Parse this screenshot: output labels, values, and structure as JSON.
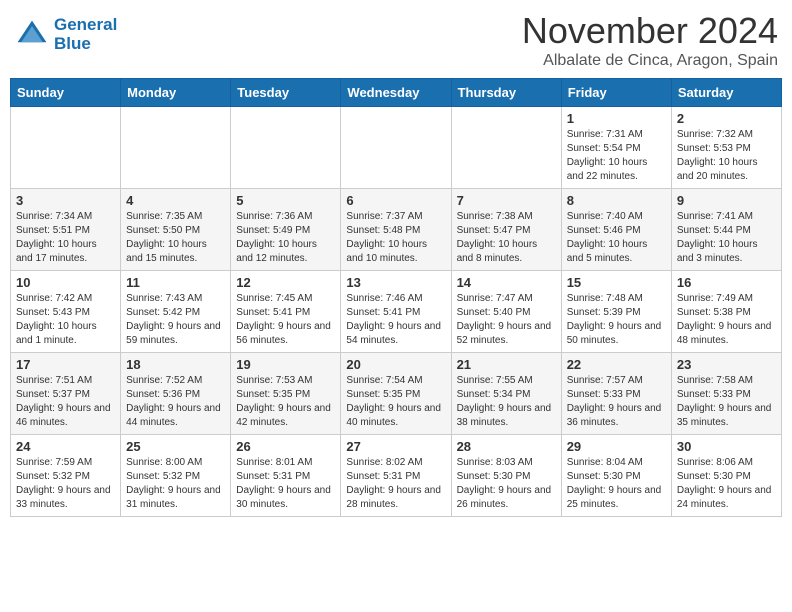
{
  "header": {
    "logo_line1": "General",
    "logo_line2": "Blue",
    "month_title": "November 2024",
    "location": "Albalate de Cinca, Aragon, Spain"
  },
  "weekdays": [
    "Sunday",
    "Monday",
    "Tuesday",
    "Wednesday",
    "Thursday",
    "Friday",
    "Saturday"
  ],
  "weeks": [
    [
      {
        "day": "",
        "info": ""
      },
      {
        "day": "",
        "info": ""
      },
      {
        "day": "",
        "info": ""
      },
      {
        "day": "",
        "info": ""
      },
      {
        "day": "",
        "info": ""
      },
      {
        "day": "1",
        "info": "Sunrise: 7:31 AM\nSunset: 5:54 PM\nDaylight: 10 hours and 22 minutes."
      },
      {
        "day": "2",
        "info": "Sunrise: 7:32 AM\nSunset: 5:53 PM\nDaylight: 10 hours and 20 minutes."
      }
    ],
    [
      {
        "day": "3",
        "info": "Sunrise: 7:34 AM\nSunset: 5:51 PM\nDaylight: 10 hours and 17 minutes."
      },
      {
        "day": "4",
        "info": "Sunrise: 7:35 AM\nSunset: 5:50 PM\nDaylight: 10 hours and 15 minutes."
      },
      {
        "day": "5",
        "info": "Sunrise: 7:36 AM\nSunset: 5:49 PM\nDaylight: 10 hours and 12 minutes."
      },
      {
        "day": "6",
        "info": "Sunrise: 7:37 AM\nSunset: 5:48 PM\nDaylight: 10 hours and 10 minutes."
      },
      {
        "day": "7",
        "info": "Sunrise: 7:38 AM\nSunset: 5:47 PM\nDaylight: 10 hours and 8 minutes."
      },
      {
        "day": "8",
        "info": "Sunrise: 7:40 AM\nSunset: 5:46 PM\nDaylight: 10 hours and 5 minutes."
      },
      {
        "day": "9",
        "info": "Sunrise: 7:41 AM\nSunset: 5:44 PM\nDaylight: 10 hours and 3 minutes."
      }
    ],
    [
      {
        "day": "10",
        "info": "Sunrise: 7:42 AM\nSunset: 5:43 PM\nDaylight: 10 hours and 1 minute."
      },
      {
        "day": "11",
        "info": "Sunrise: 7:43 AM\nSunset: 5:42 PM\nDaylight: 9 hours and 59 minutes."
      },
      {
        "day": "12",
        "info": "Sunrise: 7:45 AM\nSunset: 5:41 PM\nDaylight: 9 hours and 56 minutes."
      },
      {
        "day": "13",
        "info": "Sunrise: 7:46 AM\nSunset: 5:41 PM\nDaylight: 9 hours and 54 minutes."
      },
      {
        "day": "14",
        "info": "Sunrise: 7:47 AM\nSunset: 5:40 PM\nDaylight: 9 hours and 52 minutes."
      },
      {
        "day": "15",
        "info": "Sunrise: 7:48 AM\nSunset: 5:39 PM\nDaylight: 9 hours and 50 minutes."
      },
      {
        "day": "16",
        "info": "Sunrise: 7:49 AM\nSunset: 5:38 PM\nDaylight: 9 hours and 48 minutes."
      }
    ],
    [
      {
        "day": "17",
        "info": "Sunrise: 7:51 AM\nSunset: 5:37 PM\nDaylight: 9 hours and 46 minutes."
      },
      {
        "day": "18",
        "info": "Sunrise: 7:52 AM\nSunset: 5:36 PM\nDaylight: 9 hours and 44 minutes."
      },
      {
        "day": "19",
        "info": "Sunrise: 7:53 AM\nSunset: 5:35 PM\nDaylight: 9 hours and 42 minutes."
      },
      {
        "day": "20",
        "info": "Sunrise: 7:54 AM\nSunset: 5:35 PM\nDaylight: 9 hours and 40 minutes."
      },
      {
        "day": "21",
        "info": "Sunrise: 7:55 AM\nSunset: 5:34 PM\nDaylight: 9 hours and 38 minutes."
      },
      {
        "day": "22",
        "info": "Sunrise: 7:57 AM\nSunset: 5:33 PM\nDaylight: 9 hours and 36 minutes."
      },
      {
        "day": "23",
        "info": "Sunrise: 7:58 AM\nSunset: 5:33 PM\nDaylight: 9 hours and 35 minutes."
      }
    ],
    [
      {
        "day": "24",
        "info": "Sunrise: 7:59 AM\nSunset: 5:32 PM\nDaylight: 9 hours and 33 minutes."
      },
      {
        "day": "25",
        "info": "Sunrise: 8:00 AM\nSunset: 5:32 PM\nDaylight: 9 hours and 31 minutes."
      },
      {
        "day": "26",
        "info": "Sunrise: 8:01 AM\nSunset: 5:31 PM\nDaylight: 9 hours and 30 minutes."
      },
      {
        "day": "27",
        "info": "Sunrise: 8:02 AM\nSunset: 5:31 PM\nDaylight: 9 hours and 28 minutes."
      },
      {
        "day": "28",
        "info": "Sunrise: 8:03 AM\nSunset: 5:30 PM\nDaylight: 9 hours and 26 minutes."
      },
      {
        "day": "29",
        "info": "Sunrise: 8:04 AM\nSunset: 5:30 PM\nDaylight: 9 hours and 25 minutes."
      },
      {
        "day": "30",
        "info": "Sunrise: 8:06 AM\nSunset: 5:30 PM\nDaylight: 9 hours and 24 minutes."
      }
    ]
  ]
}
